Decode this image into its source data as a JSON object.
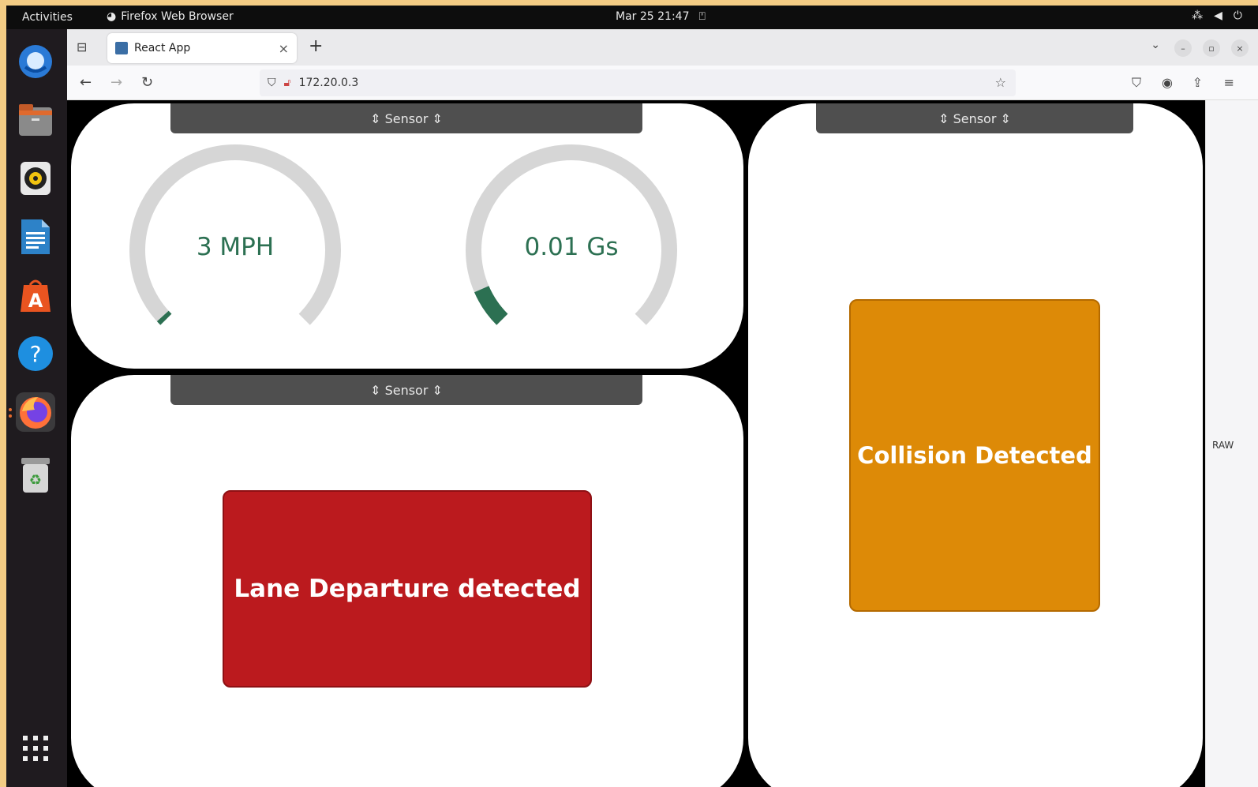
{
  "topbar": {
    "activities": "Activities",
    "app_name": "Firefox Web Browser",
    "clock": "Mar 25  21:47"
  },
  "dock": {
    "items": [
      "thunderbird-icon",
      "files-icon",
      "rhythmbox-icon",
      "writer-icon",
      "app-center-icon",
      "help-icon",
      "firefox-icon",
      "trash-icon",
      "app-grid-icon"
    ]
  },
  "browser": {
    "tab_title": "React App",
    "url": "172.20.0.3"
  },
  "sidebar_strip": {
    "label": "RAW"
  },
  "panels": {
    "gauges": {
      "header": "⇕ Sensor ⇕",
      "speed": {
        "label": "3 MPH",
        "value": 3,
        "fill": 0.01,
        "color": "#2c7052"
      },
      "accel": {
        "label": "0.01 Gs",
        "value": 0.01,
        "fill": 0.08,
        "color": "#2c7052"
      }
    },
    "lane": {
      "header": "⇕ Sensor ⇕",
      "alert": "Lane Departure detected",
      "color": "#bb1a1e"
    },
    "collision": {
      "header": "⇕ Sensor ⇕",
      "alert": "Collision Detected",
      "color": "#dd8a07"
    }
  }
}
